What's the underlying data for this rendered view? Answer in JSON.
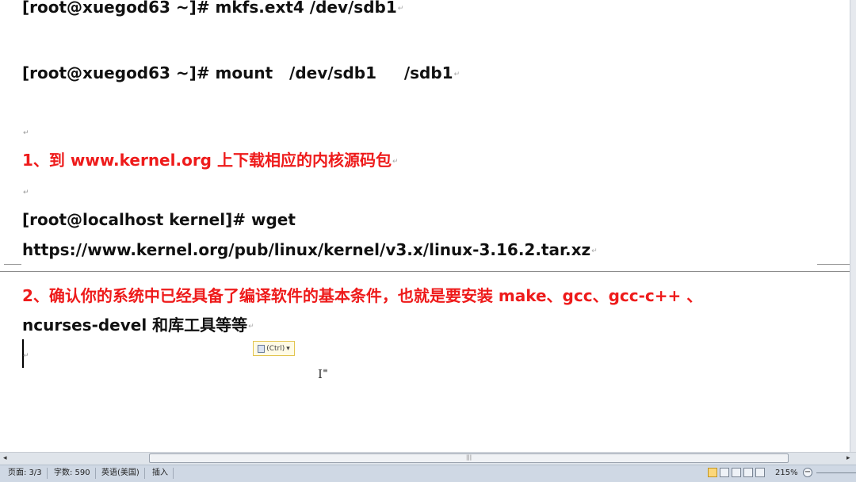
{
  "document": {
    "lines": [
      {
        "text": "[root@xuegod63 ~]# mkfs.ext4 /dev/sdb1",
        "color": "#111111"
      },
      {
        "text": "[root@xuegod63 ~]# mount   /dev/sdb1     /sdb1",
        "color": "#111111"
      },
      {
        "text": "1、到 www.kernel.org 上下载相应的内核源码包",
        "color": "#ee1b1b"
      },
      {
        "text": "[root@localhost kernel]# wget",
        "color": "#111111"
      },
      {
        "text": "https://www.kernel.org/pub/linux/kernel/v3.x/linux-3.16.2.tar.xz",
        "color": "#111111"
      },
      {
        "text": "2、确认你的系统中已经具备了编译软件的基本条件，也就是要安装 make、gcc、gcc-c++ 、",
        "color": "#ee1b1b"
      },
      {
        "text": "ncurses-devel 和库工具等等",
        "color": "#111111"
      }
    ],
    "paragraph_mark": "↵",
    "paste_options_label": "(Ctrl)",
    "paste_dropdown": "▾"
  },
  "status_bar": {
    "page": "页面: 3/3",
    "word_count": "字数: 590",
    "language": "英语(美国)",
    "insert_mode": "插入",
    "zoom": "215%",
    "zoom_minus": "−"
  },
  "scrollbar": {
    "left_arrow": "◂",
    "right_arrow": "▸",
    "grip": "|||"
  },
  "cursor": {
    "ibeam_glyph": "I"
  }
}
